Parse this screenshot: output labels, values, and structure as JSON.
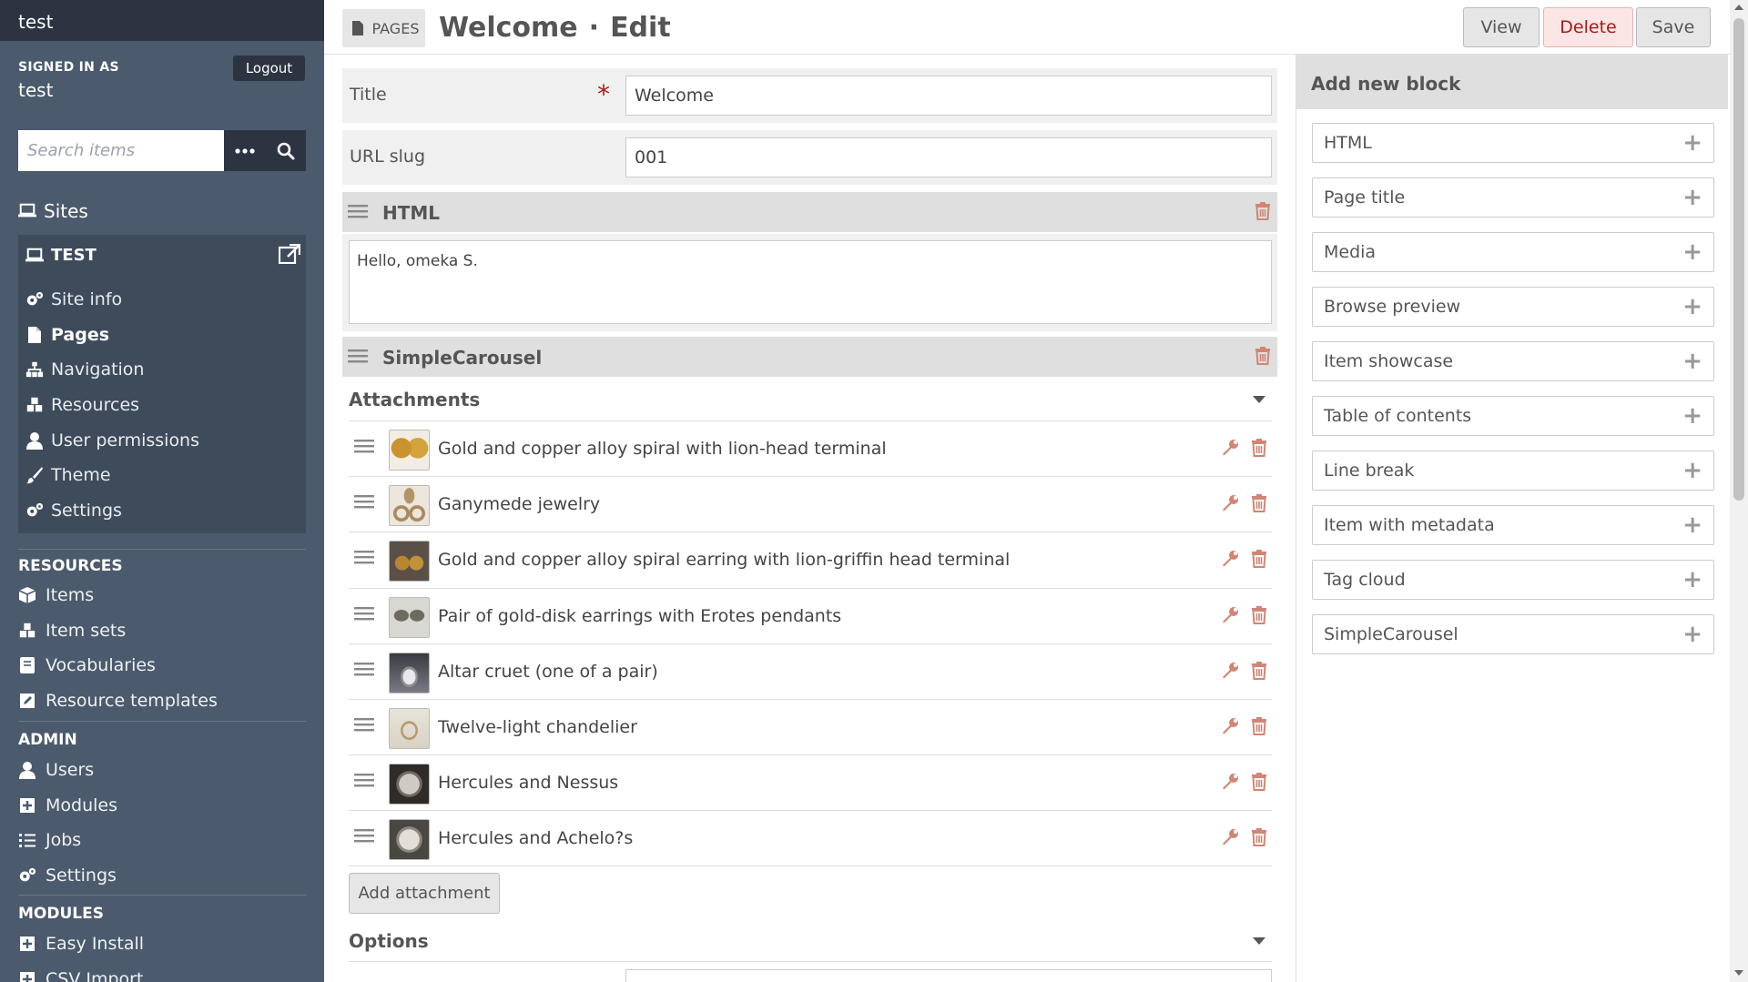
{
  "sidebar": {
    "site_title": "test",
    "signed_in_label": "Signed in as",
    "user": "test",
    "logout_label": "Logout",
    "search_placeholder": "Search items",
    "sites_label": "Sites",
    "current_site": "TEST",
    "site_nav": [
      {
        "label": "Site info",
        "icon": "gears-icon"
      },
      {
        "label": "Pages",
        "icon": "file-icon"
      },
      {
        "label": "Navigation",
        "icon": "sitemap-icon"
      },
      {
        "label": "Resources",
        "icon": "cubes-icon"
      },
      {
        "label": "User permissions",
        "icon": "user-icon"
      },
      {
        "label": "Theme",
        "icon": "brush-icon"
      },
      {
        "label": "Settings",
        "icon": "gears-icon"
      }
    ],
    "resources_label": "Resources",
    "resources": [
      {
        "label": "Items",
        "icon": "cube-icon"
      },
      {
        "label": "Item sets",
        "icon": "cubes-icon"
      },
      {
        "label": "Vocabularies",
        "icon": "book-icon"
      },
      {
        "label": "Resource templates",
        "icon": "edit-icon"
      }
    ],
    "admin_label": "Admin",
    "admin": [
      {
        "label": "Users",
        "icon": "user-icon"
      },
      {
        "label": "Modules",
        "icon": "plus-square-icon"
      },
      {
        "label": "Jobs",
        "icon": "list-icon"
      },
      {
        "label": "Settings",
        "icon": "gears-icon"
      }
    ],
    "modules_label": "Modules",
    "modules": [
      {
        "label": "Easy Install",
        "icon": "plus-square-icon"
      },
      {
        "label": "CSV Import",
        "icon": "plus-square-icon"
      }
    ]
  },
  "header": {
    "crumb": "PAGES",
    "title": "Welcome",
    "separator": "·",
    "action": "Edit",
    "view_label": "View",
    "delete_label": "Delete",
    "save_label": "Save"
  },
  "form": {
    "title_label": "Title",
    "required_mark": "*",
    "title_value": "Welcome",
    "slug_label": "URL slug",
    "slug_value": "001"
  },
  "blocks": {
    "html_name": "HTML",
    "html_content": "Hello, omeka S.",
    "carousel_name": "SimpleCarousel",
    "attachments_label": "Attachments",
    "attachments": [
      "Gold and copper alloy spiral with lion-head terminal",
      "Ganymede jewelry",
      "Gold and copper alloy spiral earring with lion-griffin head terminal",
      "Pair of gold-disk earrings with Erotes pendants",
      "Altar cruet (one of a pair)",
      "Twelve-light chandelier",
      "Hercules and Nessus",
      "Hercules and Achelo?s"
    ],
    "add_attachment_label": "Add attachment",
    "options_label": "Options"
  },
  "right_panel": {
    "title": "Add new block",
    "blocks": [
      "HTML",
      "Page title",
      "Media",
      "Browse preview",
      "Item showcase",
      "Table of contents",
      "Line break",
      "Item with metadata",
      "Tag cloud",
      "SimpleCarousel"
    ],
    "plus": "+"
  },
  "colors": {
    "sidebar_bg": "#4b5a6c",
    "sidebar_dark": "#2c3441",
    "danger": "#a91919",
    "icon_accent": "#d18574"
  }
}
